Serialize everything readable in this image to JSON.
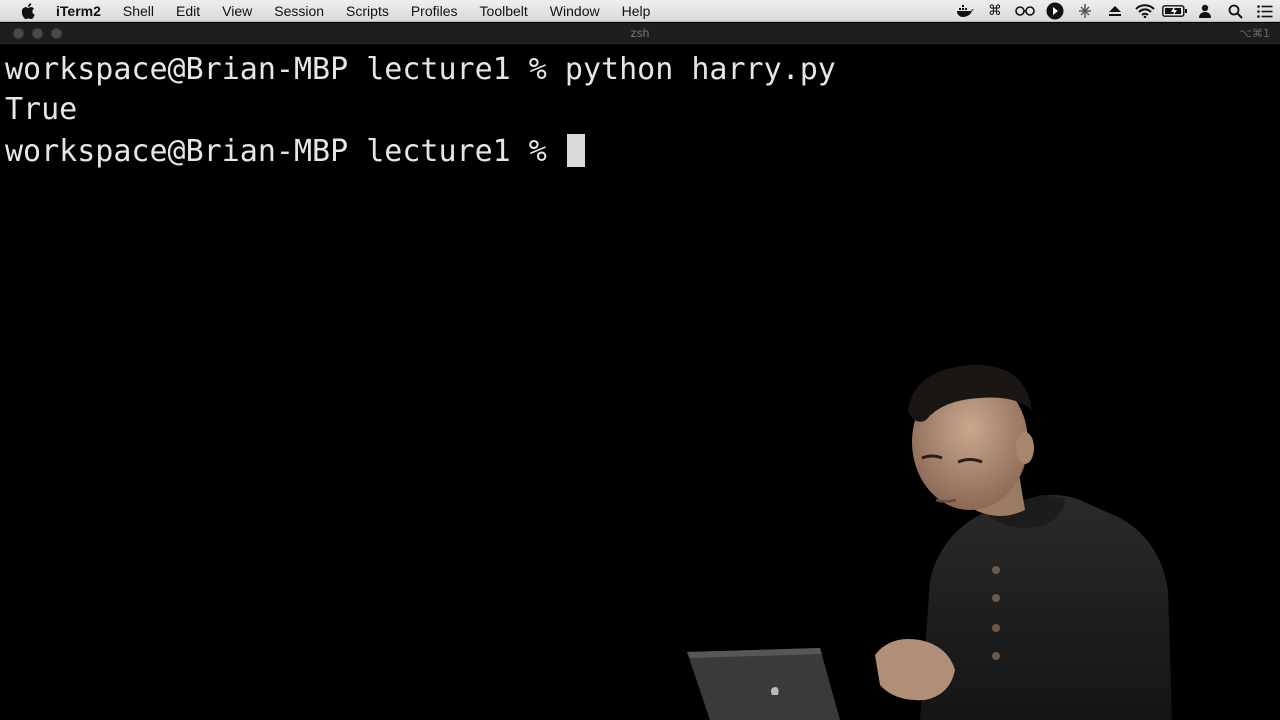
{
  "menubar": {
    "app_name": "iTerm2",
    "items": [
      "Shell",
      "Edit",
      "View",
      "Session",
      "Scripts",
      "Profiles",
      "Toolbelt",
      "Window",
      "Help"
    ],
    "status_icons": [
      "docker-icon",
      "command-icon",
      "glasses-icon",
      "play-icon",
      "extension-icon",
      "eject-icon",
      "wifi-icon",
      "battery-icon",
      "user-icon",
      "search-icon",
      "list-icon"
    ]
  },
  "window": {
    "title": "zsh",
    "shortcut": "⌥⌘1"
  },
  "terminal": {
    "lines": [
      {
        "prompt": "workspace@Brian-MBP lecture1 % ",
        "command": "python harry.py"
      },
      {
        "output": "True"
      },
      {
        "prompt": "workspace@Brian-MBP lecture1 % ",
        "command": ""
      }
    ]
  },
  "colors": {
    "terminal_bg": "#000000",
    "terminal_fg": "#e6e6e6",
    "menubar_bg": "#e4e4e4"
  }
}
